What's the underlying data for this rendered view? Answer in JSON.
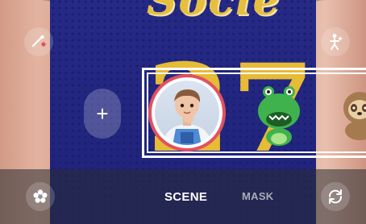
{
  "camera": {
    "jersey_text": "Socle",
    "jersey_number": "27"
  },
  "controls": {
    "top_left_icon": "magic-wand-icon",
    "top_right_icon": "body-effects-icon",
    "add_label": "+",
    "bottom_left_icon": "flower-icon",
    "bottom_right_icon": "switch-camera-icon"
  },
  "stickers": [
    {
      "name": "boy-avatar",
      "selected": true
    },
    {
      "name": "green-dino"
    },
    {
      "name": "sloth"
    }
  ],
  "modes": {
    "scene": "SCENE",
    "mask": "MASK",
    "active": "SCENE"
  },
  "colors": {
    "selection_ring": "#e15160",
    "active_mode": "#ffffff",
    "inactive_mode": "#a7adb5"
  }
}
